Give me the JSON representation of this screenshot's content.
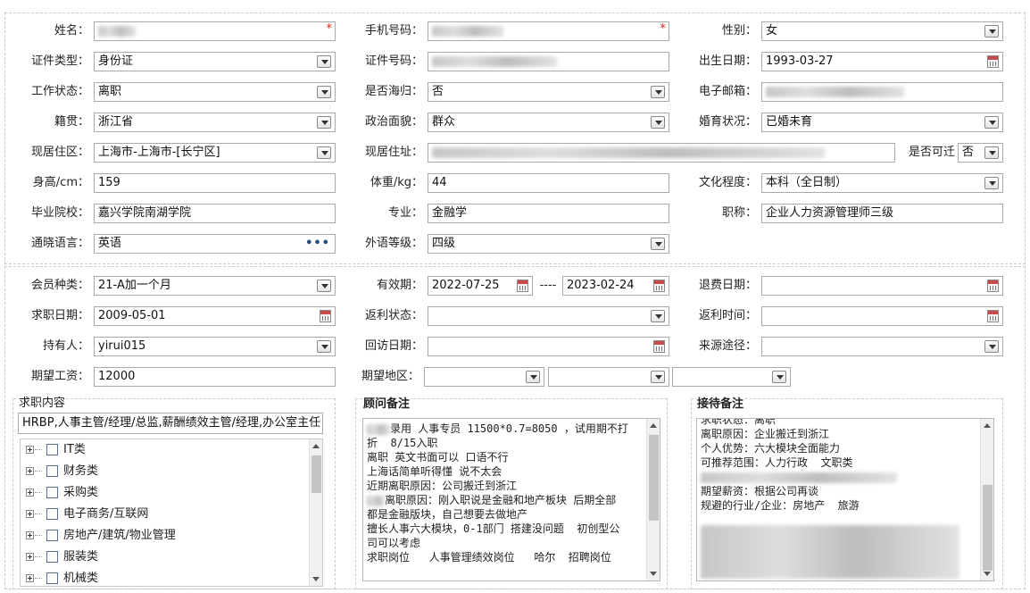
{
  "personal": {
    "name": {
      "label": "姓名："
    },
    "mobile": {
      "label": "手机号码："
    },
    "gender": {
      "label": "性别：",
      "value": "女"
    },
    "id_type": {
      "label": "证件类型：",
      "value": "身份证"
    },
    "id_number": {
      "label": "证件号码："
    },
    "birth_date": {
      "label": "出生日期：",
      "value": "1993-03-27"
    },
    "work_status": {
      "label": "工作状态：",
      "value": "离职"
    },
    "returnee": {
      "label": "是否海归：",
      "value": "否"
    },
    "email": {
      "label": "电子邮箱："
    },
    "native_place": {
      "label": "籍贯：",
      "value": "浙江省"
    },
    "political": {
      "label": "政治面貌：",
      "value": "群众"
    },
    "marital": {
      "label": "婚育状况：",
      "value": "已婚未育"
    },
    "residence_area": {
      "label": "现居住区：",
      "value": "上海市-上海市-[长宁区]"
    },
    "residence_address": {
      "label": "现居住址："
    },
    "relocatable": {
      "label": "是否可迁",
      "value": "否"
    },
    "height": {
      "label": "身高/cm：",
      "value": "159"
    },
    "weight": {
      "label": "体重/kg：",
      "value": "44"
    },
    "education": {
      "label": "文化程度：",
      "value": "本科（全日制）"
    },
    "school": {
      "label": "毕业院校：",
      "value": "嘉兴学院南湖学院"
    },
    "major": {
      "label": "专业：",
      "value": "金融学"
    },
    "title": {
      "label": "职称：",
      "value": "企业人力资源管理师三级"
    },
    "languages": {
      "label": "通晓语言：",
      "value": "英语"
    },
    "foreign_level": {
      "label": "外语等级：",
      "value": "四级"
    }
  },
  "membership": {
    "type": {
      "label": "会员种类：",
      "value": "21-A加一个月"
    },
    "validity": {
      "label": "有效期：",
      "start": "2022-07-25",
      "sep": "----",
      "end": "2023-02-24"
    },
    "refund_date": {
      "label": "退费日期："
    },
    "job_date": {
      "label": "求职日期：",
      "value": "2009-05-01"
    },
    "rebate_status": {
      "label": "返利状态："
    },
    "rebate_time": {
      "label": "返利时间："
    },
    "holder": {
      "label": "持有人：",
      "value": "yirui015"
    },
    "revisit_date": {
      "label": "回访日期："
    },
    "source": {
      "label": "来源途径："
    },
    "expected_salary": {
      "label": "期望工资：",
      "value": "12000"
    },
    "expected_area": {
      "label": "期望地区："
    }
  },
  "job_content": {
    "title": "求职内容",
    "summary": "HRBP,人事主管/经理/总监,薪酬绩效主管/经理,办公室主任",
    "tree": [
      "IT类",
      "财务类",
      "采购类",
      "电子商务/互联网",
      "房地产/建筑/物业管理",
      "服装类",
      "机械类"
    ]
  },
  "advisor_notes": {
    "title": "顾问备注",
    "lines": [
      "录用 人事专员 11500*0.7=8050 ，试用期不打",
      "折  8/15入职",
      "",
      "",
      "离职 英文书面可以 口语不行",
      "上海话简单听得懂 说不太会",
      "近期离职原因：公司搬迁到浙江",
      "离职原因：刚入职说是金融和地产板块 后期全部",
      "都是金融版块，自己想要去做地产",
      "擅长人事六大模块，0-1部门 搭建没问题  初创型公",
      "司可以考虑",
      "求职岗位   人事管理绩效岗位   哈尔  招聘岗位"
    ]
  },
  "reception_notes": {
    "title": "接待备注",
    "lines": [
      "求职状态：离职",
      "离职原因：企业搬迁到浙江",
      "个人优势：六大模块全面能力",
      "可推荐范围：人力行政  文职类",
      "",
      "期望薪资：根据公司再谈",
      "规避的行业/企业：房地产  旅游"
    ]
  },
  "colors": {
    "required": "#e0201f",
    "border": "#a9a9a9"
  }
}
